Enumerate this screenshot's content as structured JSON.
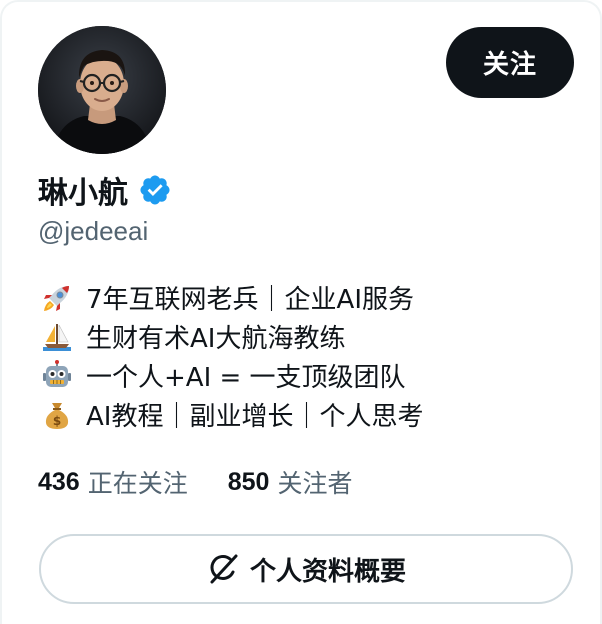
{
  "profile": {
    "display_name": "琳小航",
    "handle": "@jedeeai",
    "verified": true,
    "avatar_icon": "person-avatar"
  },
  "follow_button": {
    "label": "关注"
  },
  "bio": [
    {
      "icon": "rocket-icon",
      "text": "7年互联网老兵｜企业AI服务"
    },
    {
      "icon": "sailboat-icon",
      "text": "生财有术AI大航海教练"
    },
    {
      "icon": "robot-icon",
      "text": "一个人+AI = 一支顶级团队"
    },
    {
      "icon": "money-bag-icon",
      "text": "AI教程｜副业增长｜个人思考"
    }
  ],
  "stats": {
    "following_count": "436",
    "following_label": "正在关注",
    "followers_count": "850",
    "followers_label": "关注者"
  },
  "profile_summary_button": {
    "label": "个人资料概要",
    "icon": "grok-icon"
  },
  "colors": {
    "primary_text": "#0f1419",
    "secondary_text": "#536471",
    "verified_blue": "#1d9bf0",
    "button_dark": "#0f1419",
    "border": "#cfd9de"
  }
}
